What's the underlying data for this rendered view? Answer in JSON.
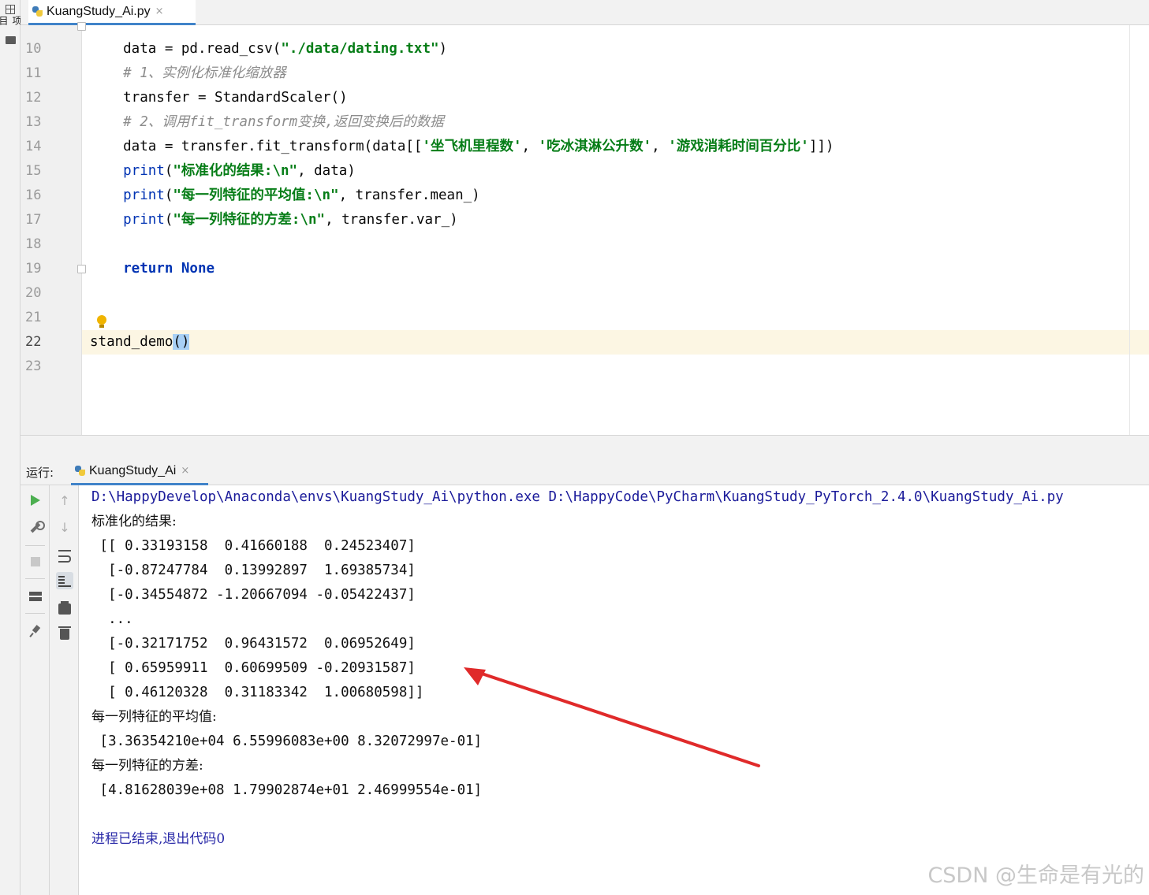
{
  "sidebar": {
    "project_label": "项目"
  },
  "editor_tab": {
    "title": "KuangStudy_Ai.py",
    "close": "×"
  },
  "gutter": {
    "lines": [
      "10",
      "11",
      "12",
      "13",
      "14",
      "15",
      "16",
      "17",
      "18",
      "19",
      "20",
      "21",
      "22",
      "23"
    ],
    "current_line": "22"
  },
  "code": {
    "l10": {
      "a": "    data = pd.read_csv(",
      "s": "\"./data/dating.txt\"",
      "b": ")"
    },
    "l11": "    # 1、实例化标准化缩放器",
    "l12": "    transfer = StandardScaler()",
    "l13": "    # 2、调用fit_transform变换,返回变换后的数据",
    "l14": {
      "a": "    data = transfer.fit_transform(data[[",
      "s1": "'坐飞机里程数'",
      "c1": ", ",
      "s2": "'吃冰淇淋公升数'",
      "c2": ", ",
      "s3": "'游戏消耗时间百分比'",
      "b": "]])"
    },
    "l15": {
      "fn": "    print",
      "o": "(",
      "s": "\"标准化的结果:\\n\"",
      "b": ", data)"
    },
    "l16": {
      "fn": "    print",
      "o": "(",
      "s": "\"每一列特征的平均值:\\n\"",
      "b": ", transfer.mean_)"
    },
    "l17": {
      "fn": "    print",
      "o": "(",
      "s": "\"每一列特征的方差:\\n\"",
      "b": ", transfer.var_)"
    },
    "l19": {
      "kw1": "    return",
      "kw2": " None"
    },
    "l22": {
      "a": "stand_demo",
      "p": "()"
    }
  },
  "run_panel": {
    "title": "运行:",
    "tab": "KuangStudy_Ai",
    "close": "×"
  },
  "console": {
    "command": "D:\\HappyDevelop\\Anaconda\\envs\\KuangStudy_Ai\\python.exe D:\\HappyCode\\PyCharm\\KuangStudy_PyTorch_2.4.0\\KuangStudy_Ai.py",
    "label_result": "标准化的结果:",
    "rows": [
      " [[ 0.33193158  0.41660188  0.24523407]",
      "  [-0.87247784  0.13992897  1.69385734]",
      "  [-0.34554872 -1.20667094 -0.05422437]",
      "  ...",
      "  [-0.32171752  0.96431572  0.06952649]",
      "  [ 0.65959911  0.60699509 -0.20931587]",
      "  [ 0.46120328  0.31183342  1.00680598]]"
    ],
    "label_mean": "每一列特征的平均值:",
    "mean_values": " [3.36354210e+04 6.55996083e+00 8.32072997e-01]",
    "label_var": "每一列特征的方差:",
    "var_values": " [4.81628039e+08 1.79902874e+01 2.46999554e-01]",
    "exit_message": "进程已结束,退出代码0"
  },
  "annotation": {
    "arrow_color": "#e02a2a"
  },
  "watermark": "CSDN @生命是有光的"
}
